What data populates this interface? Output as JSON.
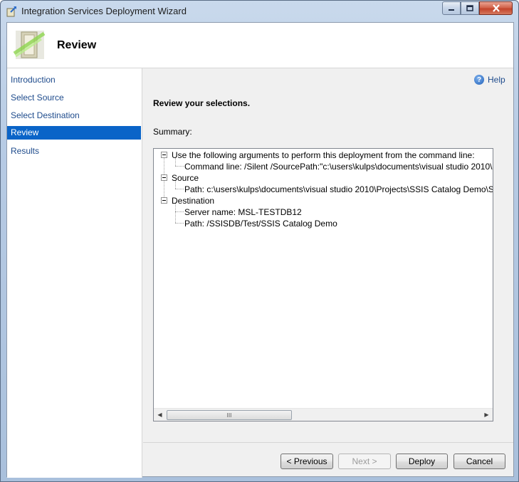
{
  "window": {
    "title": "Integration Services Deployment Wizard"
  },
  "header": {
    "title": "Review"
  },
  "nav": {
    "items": [
      {
        "label": "Introduction"
      },
      {
        "label": "Select Source"
      },
      {
        "label": "Select Destination"
      },
      {
        "label": "Review",
        "selected": true
      },
      {
        "label": "Results"
      }
    ]
  },
  "main": {
    "help_label": "Help",
    "section_title": "Review your selections.",
    "summary_label": "Summary:",
    "tree": {
      "root1": "Use the following arguments to perform this deployment from the command line:",
      "root1_child": "Command line: /Silent /SourcePath:\"c:\\users\\kulps\\documents\\visual studio 2010\\Projects\\SSIS Catalog Demo\\SSIS Catalog Demo\\bin\\Development\\SSIS Catalog Demo.ispac\"",
      "root2": "Source",
      "root2_child": "Path: c:\\users\\kulps\\documents\\visual studio 2010\\Projects\\SSIS Catalog Demo\\SSIS Catalog Demo\\bin\\Development\\SSIS Catalog Demo.ispac",
      "root3": "Destination",
      "root3_child1": "Server name: MSL-TESTDB12",
      "root3_child2": "Path: /SSISDB/Test/SSIS Catalog Demo"
    },
    "scroll_thumb_grip": "III"
  },
  "buttons": {
    "previous": "< Previous",
    "next": "Next >",
    "deploy": "Deploy",
    "cancel": "Cancel"
  }
}
